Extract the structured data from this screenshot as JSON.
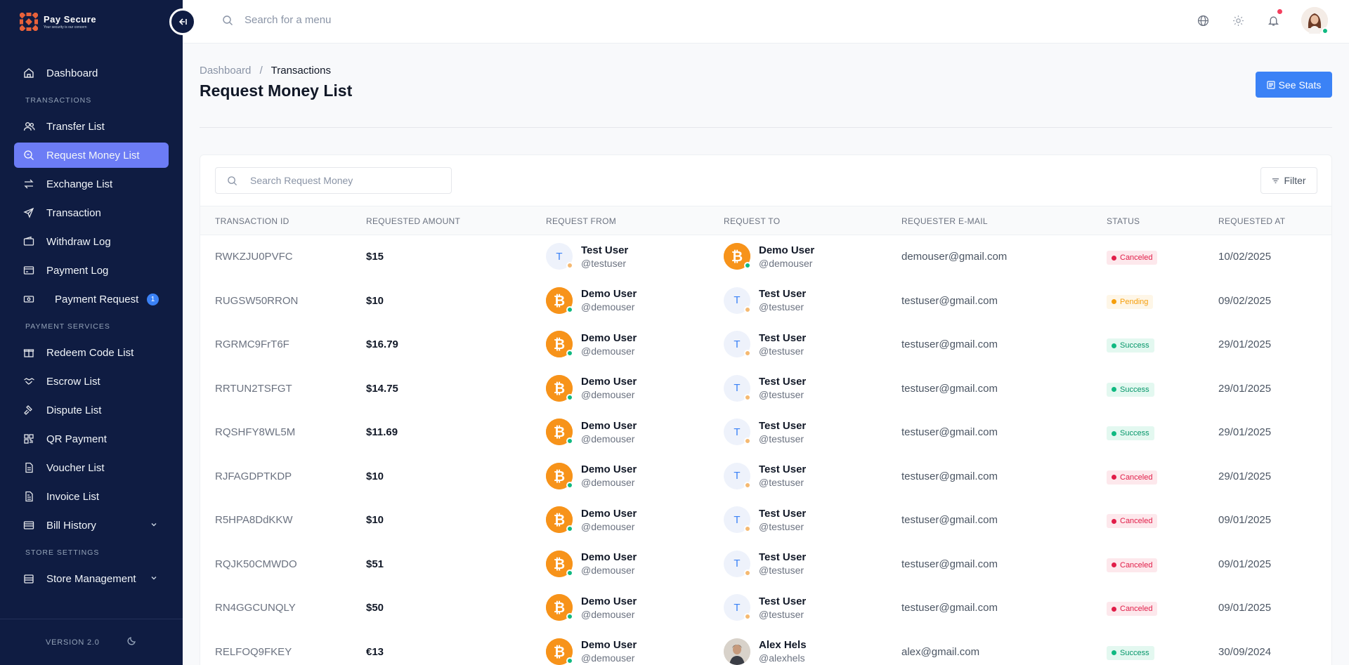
{
  "brand": {
    "name": "Pay Secure",
    "tagline": "Your security is our concern"
  },
  "search": {
    "placeholder": "Search for a menu"
  },
  "sidebar": {
    "dashboard": "Dashboard",
    "section_transactions": "TRANSACTIONS",
    "transactions": [
      {
        "label": "Transfer List",
        "icon": "users-icon"
      },
      {
        "label": "Request Money List",
        "icon": "search-money-icon",
        "active": true
      },
      {
        "label": "Exchange List",
        "icon": "exchange-icon"
      },
      {
        "label": "Transaction",
        "icon": "send-icon"
      },
      {
        "label": "Withdraw Log",
        "icon": "wallet-icon"
      },
      {
        "label": "Payment Log",
        "icon": "card-icon"
      },
      {
        "label": "Payment Request",
        "icon": "money-icon",
        "badge": "1"
      }
    ],
    "section_payment": "PAYMENT SERVICES",
    "payment": [
      {
        "label": "Redeem Code List",
        "icon": "gift-icon"
      },
      {
        "label": "Escrow List",
        "icon": "handshake-icon"
      },
      {
        "label": "Dispute List",
        "icon": "gavel-icon"
      },
      {
        "label": "QR Payment",
        "icon": "qr-icon"
      },
      {
        "label": "Voucher List",
        "icon": "voucher-icon"
      },
      {
        "label": "Invoice List",
        "icon": "invoice-icon"
      },
      {
        "label": "Bill History",
        "icon": "bill-icon",
        "expandable": true
      }
    ],
    "section_store": "STORE SETTINGS",
    "store": [
      {
        "label": "Store Management",
        "icon": "store-icon",
        "expandable": true
      }
    ],
    "version": "VERSION 2.0"
  },
  "breadcrumb": {
    "root": "Dashboard",
    "separator": "/",
    "current": "Transactions"
  },
  "page_title": "Request Money List",
  "stats_button": "See Stats",
  "table": {
    "search_placeholder": "Search Request Money",
    "filter_label": "Filter",
    "columns": [
      "TRANSACTION ID",
      "REQUESTED AMOUNT",
      "REQUEST FROM",
      "REQUEST TO",
      "REQUESTER E-MAIL",
      "STATUS",
      "REQUESTED AT"
    ],
    "rows": [
      {
        "id": "RWKZJU0PVFC",
        "amount": "$15",
        "from": {
          "name": "Test User",
          "handle": "@testuser",
          "avatar": "T"
        },
        "to": {
          "name": "Demo User",
          "handle": "@demouser",
          "avatar": "btc"
        },
        "email": "demouser@gmail.com",
        "status": "Canceled",
        "date": "10/02/2025"
      },
      {
        "id": "RUGSW50RRON",
        "amount": "$10",
        "from": {
          "name": "Demo User",
          "handle": "@demouser",
          "avatar": "btc"
        },
        "to": {
          "name": "Test User",
          "handle": "@testuser",
          "avatar": "T"
        },
        "email": "testuser@gmail.com",
        "status": "Pending",
        "date": "09/02/2025"
      },
      {
        "id": "RGRMC9FrT6F",
        "amount": "$16.79",
        "from": {
          "name": "Demo User",
          "handle": "@demouser",
          "avatar": "btc"
        },
        "to": {
          "name": "Test User",
          "handle": "@testuser",
          "avatar": "T"
        },
        "email": "testuser@gmail.com",
        "status": "Success",
        "date": "29/01/2025"
      },
      {
        "id": "RRTUN2TSFGT",
        "amount": "$14.75",
        "from": {
          "name": "Demo User",
          "handle": "@demouser",
          "avatar": "btc"
        },
        "to": {
          "name": "Test User",
          "handle": "@testuser",
          "avatar": "T"
        },
        "email": "testuser@gmail.com",
        "status": "Success",
        "date": "29/01/2025"
      },
      {
        "id": "RQSHFY8WL5M",
        "amount": "$11.69",
        "from": {
          "name": "Demo User",
          "handle": "@demouser",
          "avatar": "btc"
        },
        "to": {
          "name": "Test User",
          "handle": "@testuser",
          "avatar": "T"
        },
        "email": "testuser@gmail.com",
        "status": "Success",
        "date": "29/01/2025"
      },
      {
        "id": "RJFAGDPTKDP",
        "amount": "$10",
        "from": {
          "name": "Demo User",
          "handle": "@demouser",
          "avatar": "btc"
        },
        "to": {
          "name": "Test User",
          "handle": "@testuser",
          "avatar": "T"
        },
        "email": "testuser@gmail.com",
        "status": "Canceled",
        "date": "29/01/2025"
      },
      {
        "id": "R5HPA8DdKKW",
        "amount": "$10",
        "from": {
          "name": "Demo User",
          "handle": "@demouser",
          "avatar": "btc"
        },
        "to": {
          "name": "Test User",
          "handle": "@testuser",
          "avatar": "T"
        },
        "email": "testuser@gmail.com",
        "status": "Canceled",
        "date": "09/01/2025"
      },
      {
        "id": "RQJK50CMWDO",
        "amount": "$51",
        "from": {
          "name": "Demo User",
          "handle": "@demouser",
          "avatar": "btc"
        },
        "to": {
          "name": "Test User",
          "handle": "@testuser",
          "avatar": "T"
        },
        "email": "testuser@gmail.com",
        "status": "Canceled",
        "date": "09/01/2025"
      },
      {
        "id": "RN4GGCUNQLY",
        "amount": "$50",
        "from": {
          "name": "Demo User",
          "handle": "@demouser",
          "avatar": "btc"
        },
        "to": {
          "name": "Test User",
          "handle": "@testuser",
          "avatar": "T"
        },
        "email": "testuser@gmail.com",
        "status": "Canceled",
        "date": "09/01/2025"
      },
      {
        "id": "RELFOQ9FKEY",
        "amount": "€13",
        "from": {
          "name": "Demo User",
          "handle": "@demouser",
          "avatar": "btc"
        },
        "to": {
          "name": "Alex Hels",
          "handle": "@alexhels",
          "avatar": "photo"
        },
        "email": "alex@gmail.com",
        "status": "Success",
        "date": "30/09/2024"
      }
    ]
  },
  "colors": {
    "sidebar_bg": "#0f1c42",
    "active_nav": "#6c7cf5",
    "primary": "#3b82f6",
    "canceled": "#e11d48",
    "pending": "#f59e0b",
    "success": "#10b981"
  }
}
